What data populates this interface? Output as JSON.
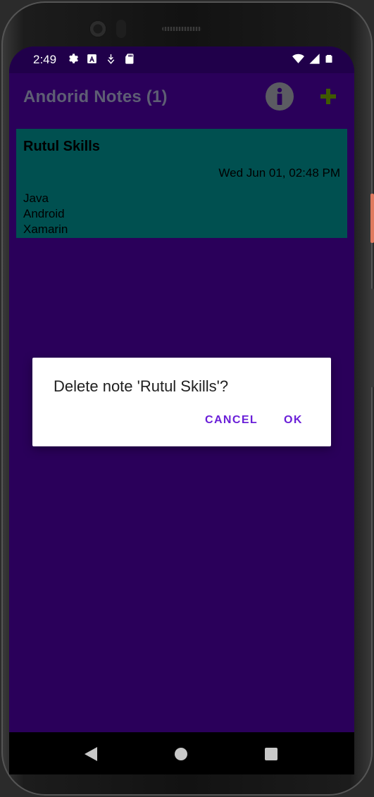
{
  "status_bar": {
    "time": "2:49",
    "left_icons": [
      "settings-icon",
      "a-icon",
      "download-icon",
      "sd-card-icon"
    ],
    "right_icons": [
      "wifi-icon",
      "signal-icon",
      "battery-icon"
    ]
  },
  "toolbar": {
    "title": "Andorid Notes (1)",
    "info_icon": "info-icon",
    "add_icon": "add-icon"
  },
  "notes": [
    {
      "title": "Rutul Skills",
      "date": "Wed Jun 01, 02:48 PM",
      "body_lines": [
        "Java",
        "Android",
        "Xamarin"
      ]
    }
  ],
  "dialog": {
    "message": "Delete note 'Rutul Skills'?",
    "cancel_label": "CANCEL",
    "ok_label": "OK"
  },
  "nav_bar": {
    "buttons": [
      "back-icon",
      "home-icon",
      "recents-icon"
    ]
  },
  "colors": {
    "background": "#2a005a",
    "status_bar": "#20004a",
    "note_card": "#005050",
    "title_text": "#5e5e74",
    "add_icon": "#3f5a00",
    "dialog_button": "#6a1fd8"
  }
}
